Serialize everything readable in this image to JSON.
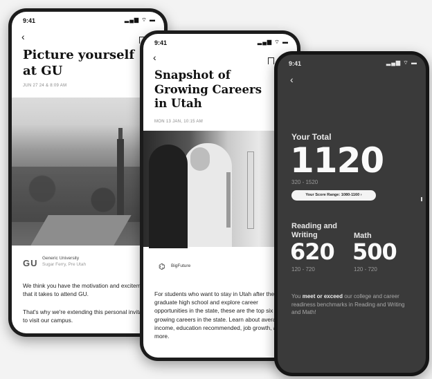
{
  "phone1": {
    "status_time": "9:41",
    "status_icons": "▂▄▆ ⌔ ▬",
    "back": "‹",
    "title": "Picture yourself at GU",
    "date": "JUN 27 24 & 8:09 AM",
    "org_logo": "GU",
    "org_name": "Generic University",
    "org_subtitle": "Sugar Ferry, Pre Utah",
    "paragraph1": "We think you have the motivation and excitement that it takes to attend GU.",
    "paragraph2": "That's why we're extending this personal invitation to visit our campus."
  },
  "phone2": {
    "status_time": "9:41",
    "status_icons": "▂▄▆ ⌔ ▬",
    "back": "‹",
    "title": "Snapshot of Growing Careers in Utah",
    "date": "MON 13 JAN, 10:15 AM",
    "org_icon": "⌬",
    "org_name": "BigFuture",
    "paragraph": "For students who want to stay in Utah after they graduate high school and explore career opportunities in the state, these are the top six growing careers in the state. Learn about average income, education recommended, job growth, and more."
  },
  "phone3": {
    "status_time": "9:41",
    "status_icons": "▂▄▆ ⌔ ▬",
    "back": "‹",
    "total_label": "Your Total",
    "total_score": "1120",
    "total_range": "320 - 1520",
    "pill_label": "Your Score Range: 1080-1160 ›",
    "rw_label": "Reading and Writing",
    "rw_score": "620",
    "rw_range": "120 - 720",
    "math_label": "Math",
    "math_score": "500",
    "math_range": "120 - 720",
    "bench_prefix": "You",
    "bench_bold": "meet or exceed",
    "bench_suffix": "our college and career readiness benchmarks in Reading and Writing and Math!"
  }
}
